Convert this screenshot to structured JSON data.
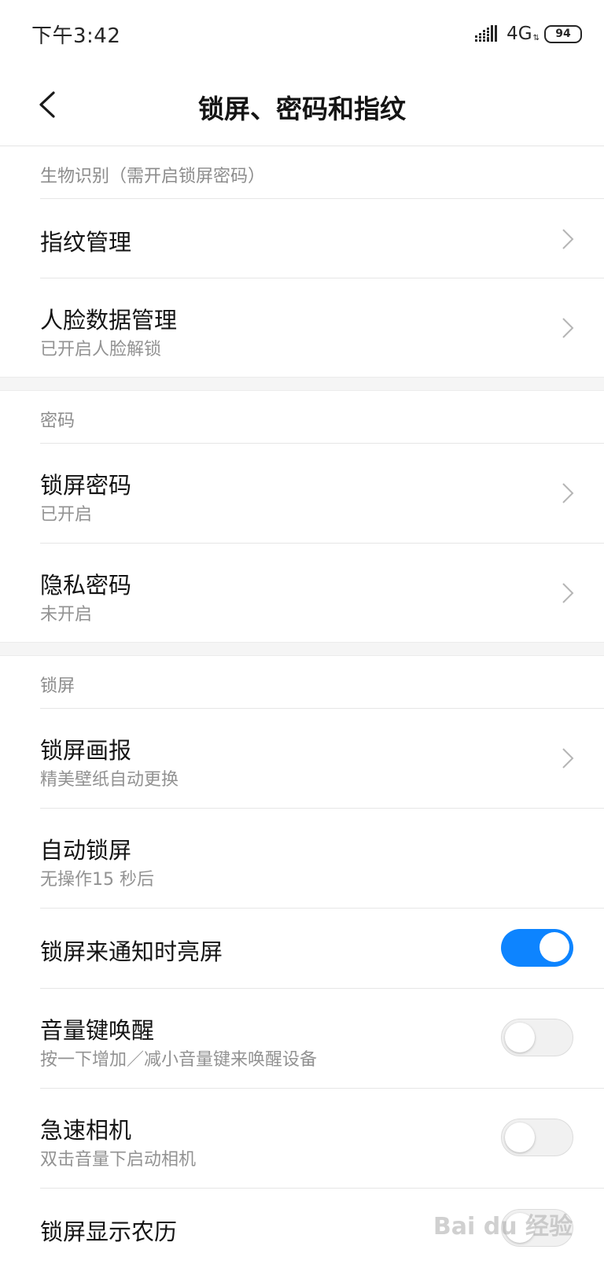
{
  "status_bar": {
    "time": "下午3:42",
    "network": "4G",
    "battery": "94"
  },
  "header": {
    "title": "锁屏、密码和指纹"
  },
  "sections": {
    "biometrics": {
      "label": "生物识别（需开启锁屏密码）",
      "items": [
        {
          "title": "指纹管理",
          "subtitle": ""
        },
        {
          "title": "人脸数据管理",
          "subtitle": "已开启人脸解锁"
        }
      ]
    },
    "password": {
      "label": "密码",
      "items": [
        {
          "title": "锁屏密码",
          "subtitle": "已开启"
        },
        {
          "title": "隐私密码",
          "subtitle": "未开启"
        }
      ]
    },
    "lockscreen": {
      "label": "锁屏",
      "items": [
        {
          "title": "锁屏画报",
          "subtitle": "精美壁纸自动更换"
        },
        {
          "title": "自动锁屏",
          "subtitle": "无操作15 秒后"
        },
        {
          "title": "锁屏来通知时亮屏",
          "subtitle": "",
          "toggle": "on"
        },
        {
          "title": "音量键唤醒",
          "subtitle": "按一下增加／减小音量键来唤醒设备",
          "toggle": "off"
        },
        {
          "title": "急速相机",
          "subtitle": "双击音量下启动相机",
          "toggle": "off"
        },
        {
          "title": "锁屏显示农历",
          "subtitle": "",
          "toggle": "off"
        }
      ]
    }
  },
  "watermark": "Bai du 经验"
}
